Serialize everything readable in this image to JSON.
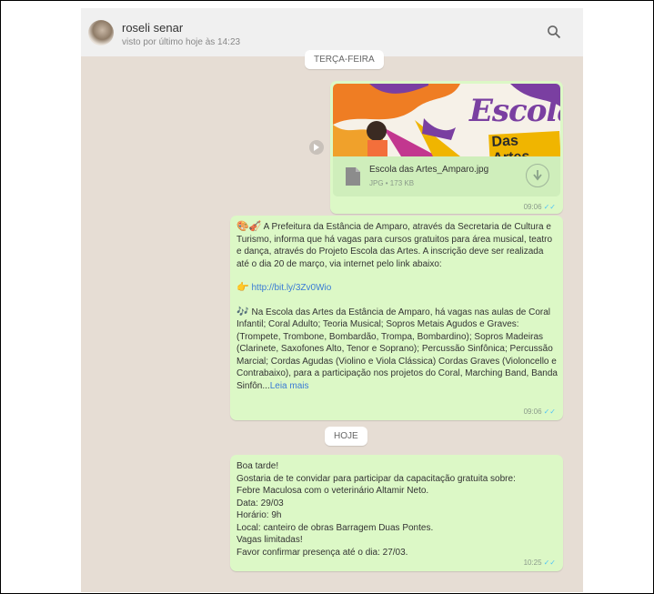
{
  "header": {
    "contact_name": "roseli senar",
    "last_seen": "visto por último hoje às 14:23"
  },
  "dates": {
    "day1": "TERÇA-FEIRA",
    "day2": "HOJE"
  },
  "image_message": {
    "banner_line1": "Escola",
    "banner_line2": "Das Artes",
    "file_name": "Escola das Artes_Amparo.jpg",
    "file_meta": "JPG • 173 KB",
    "time": "09:06",
    "ticks": "✓✓"
  },
  "text_message_1": {
    "emoji": "🎨🎻",
    "para1": " A Prefeitura da Estância de Amparo, através da Secretaria de Cultura e Turismo, informa que há vagas para cursos gratuitos para área musical, teatro e dança, através do Projeto Escola das Artes. A inscrição deve ser realizada até o dia 20 de março, via internet pelo link abaixo:",
    "link_emoji": "👉",
    "link": "http://bit.ly/3Zv0Wio",
    "note_emoji": "🎶",
    "para3": " Na Escola das Artes da Estância de Amparo, há vagas nas aulas de Coral Infantil; Coral Adulto; Teoria Musical; Sopros Metais Agudos e Graves: (Trompete, Trombone, Bombardão, Trompa, Bombardino); Sopros Madeiras (Clarinete, Saxofones Alto, Tenor e Soprano); Percussão Sinfônica; Percussão Marcial; Cordas Agudas (Violino e Viola Clássica) Cordas Graves (Violoncello e Contrabaixo), para a participação nos projetos do Coral, Marching Band, Banda Sinfôn...",
    "read_more": "Leia mais",
    "time": "09:06",
    "ticks": "✓✓"
  },
  "text_message_2": {
    "lines": [
      "Boa tarde!",
      "Gostaria de te convidar para participar da capacitação gratuita sobre:",
      "Febre Maculosa com o veterinário Altamir Neto.",
      "Data: 29/03",
      "Horário: 9h",
      "Local: canteiro de obras Barragem Duas Pontes.",
      "Vagas limitadas!",
      "Favor confirmar presença até o dia: 27/03."
    ],
    "time": "10:25",
    "ticks": "✓✓"
  },
  "colors": {
    "chat_bg": "#e6ddd4",
    "bubble_out": "#dcf8c6",
    "header_bg": "#f0f0f0",
    "tick_blue": "#4fc3f7"
  }
}
